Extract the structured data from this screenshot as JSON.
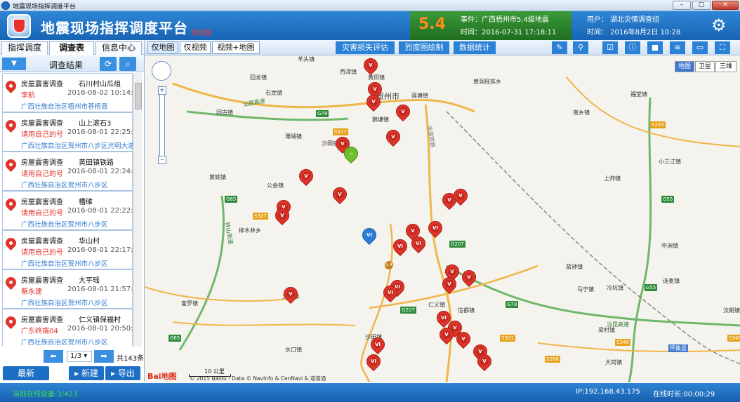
{
  "window": {
    "title": "地震现场指挥调度平台",
    "min": "–",
    "max": "▢",
    "close": "✕"
  },
  "header": {
    "title": "地震现场指挥调度平台",
    "version": "测试版",
    "magnitude": "5.4",
    "event_label": "事件：广西梧州市5.4级地震",
    "event_time": "时间：2016-07-31 17:18:11",
    "user_label": "用户： 湖北灾情调查组",
    "user_time": "时间： 2016年8月2日 10:28"
  },
  "left_tabs": [
    "指挥调度",
    "调查表",
    "信息中心"
  ],
  "panel": {
    "title": "调查结果",
    "refresh_icon": "⟳",
    "search_icon": "⌕",
    "dropdown": "▼"
  },
  "survey_items": [
    {
      "type": "房屋震害调查",
      "place": "石川村山瓜组",
      "user": "李航",
      "time": "2016-08-02 10:14:17",
      "region": "广西壮族自治区梧州市苍梧县"
    },
    {
      "type": "房屋震害调查",
      "place": "山上滚石3",
      "user": "请用自己的号",
      "time": "2016-08-01 22:25:05",
      "region": "广西壮族自治区贺州市八步区光明大道"
    },
    {
      "type": "房屋震害调查",
      "place": "黄田镇铁路",
      "user": "请用自己的号",
      "time": "2016-08-01 22:24:10",
      "region": "广西壮族自治区贺州市八步区"
    },
    {
      "type": "房屋震害调查",
      "place": "槽碓",
      "user": "请用自己的号",
      "time": "2016-08-01 22:22:43",
      "region": "广西壮族自治区贺州市八步区"
    },
    {
      "type": "房屋震害调查",
      "place": "华山村",
      "user": "请用自己的号",
      "time": "2016-08-01 22:17:00",
      "region": "广西壮族自治区贺州市八步区"
    },
    {
      "type": "房屋震害调查",
      "place": "大平瑶",
      "user": "蔡永建",
      "time": "2016-08-01 21:57:56",
      "region": "广西壮族自治区贺州市八步区"
    },
    {
      "type": "房屋震害调查",
      "place": "仁义镇保福村",
      "user": "广东终端04",
      "time": "2016-08-01 20:50:27",
      "region": "广西壮族自治区贺州市八步区"
    }
  ],
  "pager": {
    "prev": "⬅",
    "next": "➡",
    "page": "1/3 ▾",
    "total": "共143条"
  },
  "actions": {
    "latest": "最新",
    "new": "▸ 新建",
    "export": "▸ 导出"
  },
  "view_tabs": [
    "仅地图",
    "仅视频",
    "视频+地图"
  ],
  "map_tools": [
    "灾害损失评估",
    "烈度图绘制",
    "数据统计"
  ],
  "tool_icons": [
    "✎",
    "⚲",
    "☑",
    "ⓘ",
    "■",
    "≋",
    "▭",
    "⛶"
  ],
  "map_types": [
    "地图",
    "卫星",
    "三维"
  ],
  "map_labels": [
    {
      "t": "羊头镇"
    },
    {
      "t": "西湾镇"
    },
    {
      "t": "黄田镇"
    },
    {
      "t": "贺州市"
    },
    {
      "t": "莲塘镇"
    },
    {
      "t": "黄洞瑶族乡"
    },
    {
      "t": "回龙镇"
    },
    {
      "t": "石龙镇"
    },
    {
      "t": "同古镇"
    },
    {
      "t": "鹅塘镇"
    },
    {
      "t": "福堂镇"
    },
    {
      "t": "南乡镇"
    },
    {
      "t": "珊瑚镇"
    },
    {
      "t": "沙田镇"
    },
    {
      "t": "黄姚镇"
    },
    {
      "t": "公会镇"
    },
    {
      "t": "小三江镇"
    },
    {
      "t": "上帅镇"
    },
    {
      "t": "柳木林乡"
    },
    {
      "t": "中洲镇"
    },
    {
      "t": "蓝钟镇"
    },
    {
      "t": "连麦镇"
    },
    {
      "t": "马宁镇"
    },
    {
      "t": "冷坑镇"
    },
    {
      "t": "仁义镇"
    },
    {
      "t": "信都镇"
    },
    {
      "t": "富罗镇"
    },
    {
      "t": "梁村镇"
    },
    {
      "t": "怀集县"
    },
    {
      "t": "水口镇"
    },
    {
      "t": "沙田镇"
    },
    {
      "t": "大岗镇"
    },
    {
      "t": "汶朗镇"
    },
    {
      "t": "钟山高速"
    },
    {
      "t": "汕昆高速"
    },
    {
      "t": "汕昆高速"
    },
    {
      "t": "洛湛铁路"
    },
    {
      "t": "大宁镇"
    }
  ],
  "road_shields": [
    "G78",
    "S327",
    "G65",
    "S327",
    "G207",
    "G207",
    "G78",
    "G65",
    "S263",
    "G55",
    "S301",
    "S266",
    "G55",
    "S349",
    "S349"
  ],
  "scale_label": "10 公里",
  "baidu_logo": "Bai地图",
  "copyright": "© 2015 Baidu - Data © NavInfo & CenNavi & 道道通",
  "status": {
    "devices": "当前在线设备:3/423",
    "ip": "IP:192.168.43.175",
    "online": "在线时长:00:00:29"
  }
}
